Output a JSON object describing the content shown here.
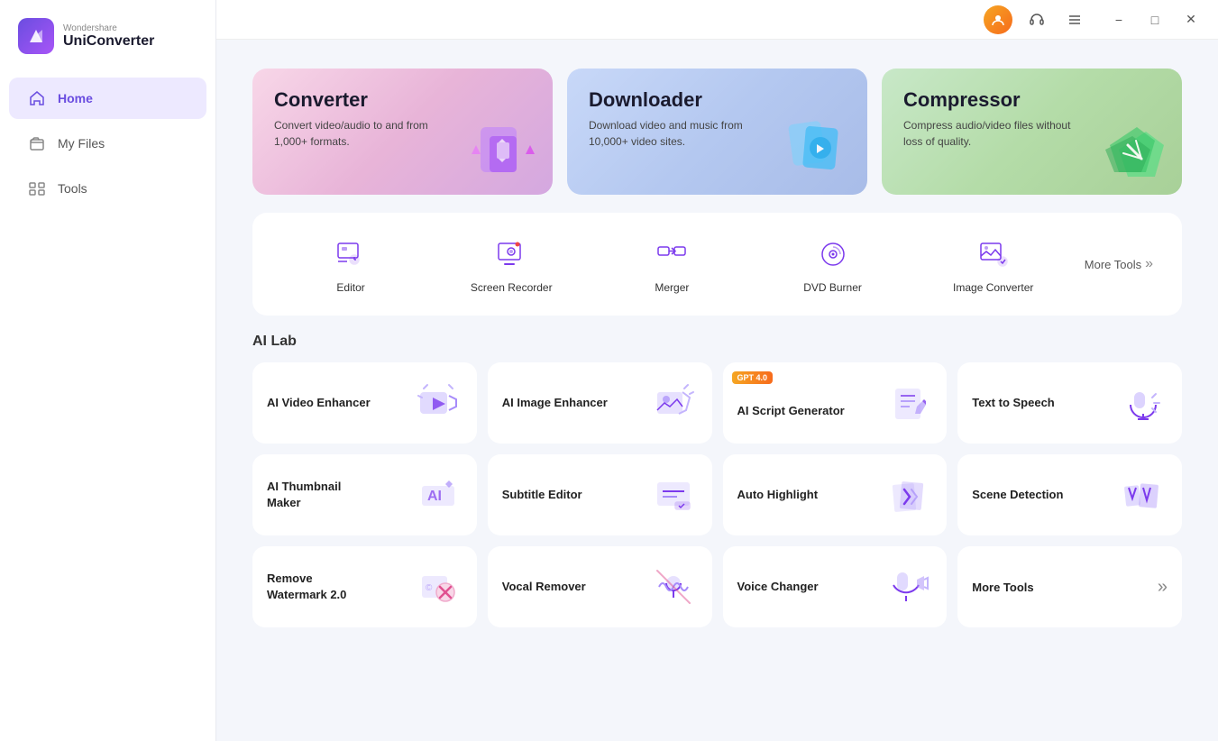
{
  "app": {
    "brand": "Wondershare",
    "name": "UniConverter"
  },
  "titlebar": {
    "user_icon": "👤",
    "headset_icon": "🎧",
    "menu_icon": "☰",
    "minimize": "−",
    "maximize": "□",
    "close": "✕"
  },
  "sidebar": {
    "items": [
      {
        "id": "home",
        "label": "Home",
        "active": true
      },
      {
        "id": "my-files",
        "label": "My Files",
        "active": false
      },
      {
        "id": "tools",
        "label": "Tools",
        "active": false
      }
    ]
  },
  "hero": {
    "cards": [
      {
        "id": "converter",
        "title": "Converter",
        "desc": "Convert video/audio to and from 1,000+ formats.",
        "type": "converter"
      },
      {
        "id": "downloader",
        "title": "Downloader",
        "desc": "Download video and music from 10,000+ video sites.",
        "type": "downloader"
      },
      {
        "id": "compressor",
        "title": "Compressor",
        "desc": "Compress audio/video files without loss of quality.",
        "type": "compressor"
      }
    ]
  },
  "tools": {
    "items": [
      {
        "id": "editor",
        "label": "Editor"
      },
      {
        "id": "screen-recorder",
        "label": "Screen Recorder"
      },
      {
        "id": "merger",
        "label": "Merger"
      },
      {
        "id": "dvd-burner",
        "label": "DVD Burner"
      },
      {
        "id": "image-converter",
        "label": "Image Converter"
      }
    ],
    "more_label": "More Tools"
  },
  "ai_lab": {
    "section_title": "AI Lab",
    "cards": [
      {
        "id": "ai-video-enhancer",
        "label": "AI Video Enhancer",
        "badge": null
      },
      {
        "id": "ai-image-enhancer",
        "label": "AI Image Enhancer",
        "badge": null
      },
      {
        "id": "ai-script-generator",
        "label": "AI Script Generator",
        "badge": "GPT 4.0"
      },
      {
        "id": "text-to-speech",
        "label": "Text to Speech",
        "badge": null
      },
      {
        "id": "ai-thumbnail-maker",
        "label": "AI Thumbnail Maker",
        "badge": null
      },
      {
        "id": "subtitle-editor",
        "label": "Subtitle Editor",
        "badge": null
      },
      {
        "id": "auto-highlight",
        "label": "Auto Highlight",
        "badge": null
      },
      {
        "id": "scene-detection",
        "label": "Scene Detection",
        "badge": null
      },
      {
        "id": "remove-watermark",
        "label": "Remove Watermark 2.0",
        "badge": null
      },
      {
        "id": "vocal-remover",
        "label": "Vocal Remover",
        "badge": null
      },
      {
        "id": "voice-changer",
        "label": "Voice Changer",
        "badge": null
      },
      {
        "id": "more-tools",
        "label": "More Tools",
        "badge": null,
        "is_more": true
      }
    ]
  }
}
